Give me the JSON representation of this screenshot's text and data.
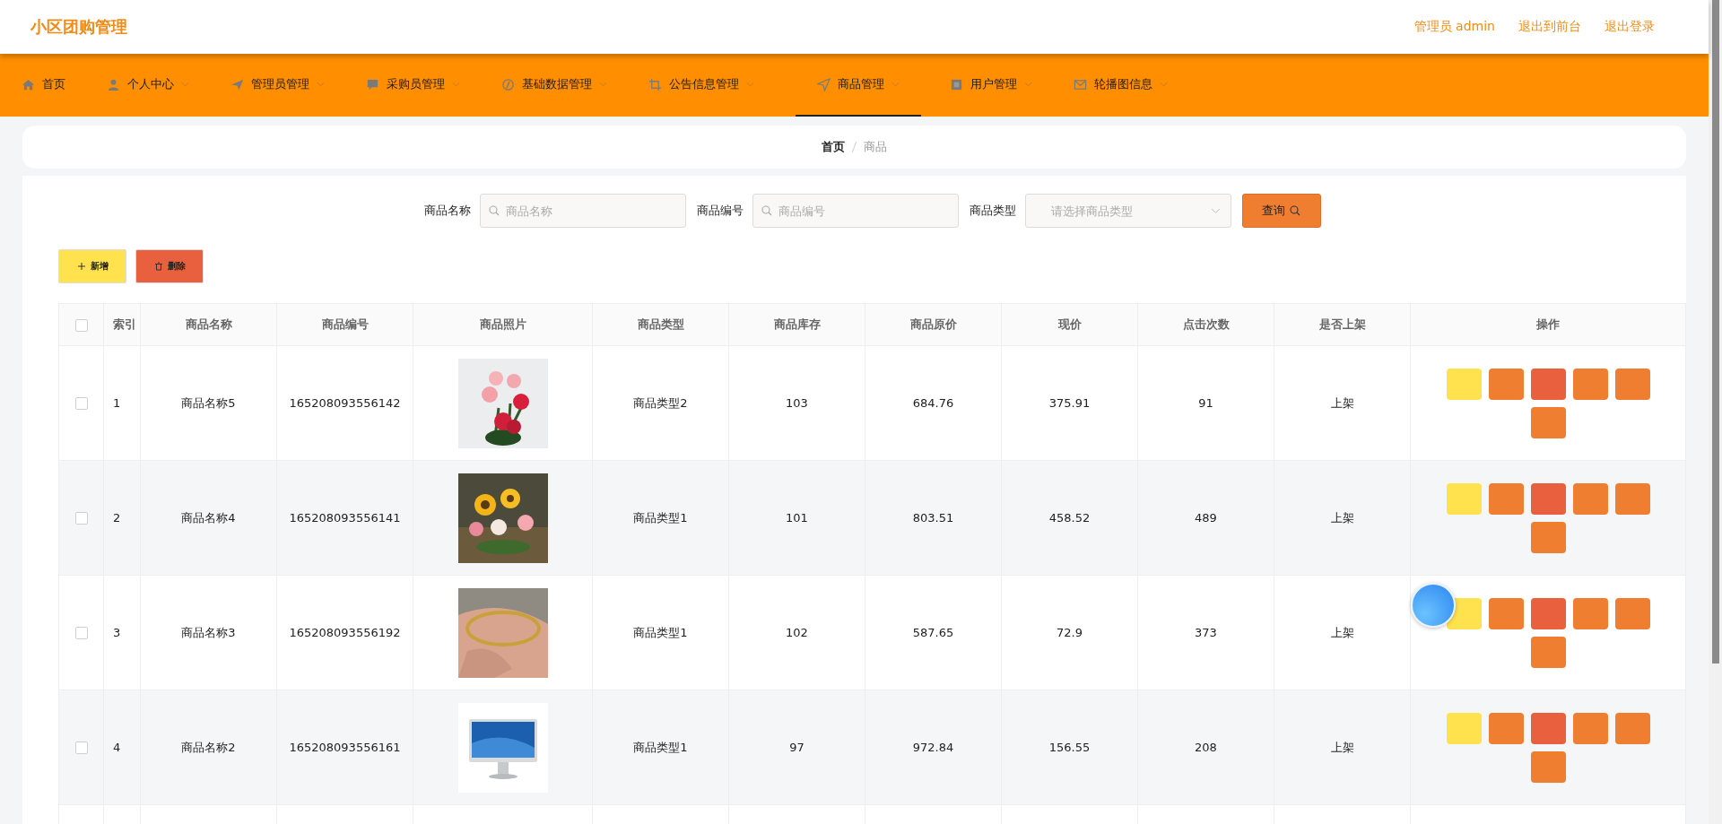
{
  "header": {
    "title": "小区团购管理",
    "links": [
      "管理员 admin",
      "退出到前台",
      "退出登录"
    ]
  },
  "nav": [
    {
      "label": "首页",
      "kind": "home",
      "has_caret": false,
      "selected": false
    },
    {
      "label": "个人中心",
      "kind": "user",
      "has_caret": true,
      "selected": false
    },
    {
      "label": "管理员管理",
      "kind": "plane",
      "has_caret": true,
      "selected": false
    },
    {
      "label": "采购员管理",
      "kind": "chat",
      "has_caret": true,
      "selected": false
    },
    {
      "label": "基础数据管理",
      "kind": "compass",
      "has_caret": true,
      "selected": false
    },
    {
      "label": "公告信息管理",
      "kind": "crop",
      "has_caret": true,
      "selected": false
    },
    {
      "label": "商品管理",
      "kind": "send",
      "has_caret": true,
      "selected": true
    },
    {
      "label": "用户管理",
      "kind": "doc",
      "has_caret": true,
      "selected": false
    },
    {
      "label": "轮播图信息",
      "kind": "mail",
      "has_caret": true,
      "selected": false
    }
  ],
  "breadcrumb": [
    "首页",
    "商品"
  ],
  "search": {
    "fields": [
      {
        "label": "商品名称",
        "placeholder": "商品名称",
        "kind": "text"
      },
      {
        "label": "商品编号",
        "placeholder": "商品编号",
        "kind": "text"
      },
      {
        "label": "商品类型",
        "placeholder": "请选择商品类型",
        "kind": "select"
      }
    ],
    "button": "查询"
  },
  "actions": [
    {
      "label": "新增",
      "kind": "add",
      "color": "#ffe24d"
    },
    {
      "label": "删除",
      "kind": "delete",
      "color": "#e8603e"
    }
  ],
  "table": {
    "all_checked": false,
    "columns": [
      "索引",
      "商品名称",
      "商品编号",
      "商品照片",
      "商品类型",
      "商品库存",
      "商品原价",
      "现价",
      "点击次数",
      "是否上架",
      "操作"
    ],
    "op_buttons": [
      {
        "color": "#ffe24d"
      },
      {
        "color": "#ef7e30"
      },
      {
        "color": "#e8603e"
      },
      {
        "color": "#ef7e30"
      },
      {
        "color": "#ef7e30"
      },
      {
        "color": "#ef7e30"
      }
    ],
    "rows": [
      {
        "checked": false,
        "index": "1",
        "name": "商品名称5",
        "code": "165208093556142",
        "type": "商品类型2",
        "stock": "103",
        "price": "684.76",
        "now": "375.91",
        "clicks": "91",
        "shelf": "上架"
      },
      {
        "checked": false,
        "index": "2",
        "name": "商品名称4",
        "code": "165208093556141",
        "type": "商品类型1",
        "stock": "101",
        "price": "803.51",
        "now": "458.52",
        "clicks": "489",
        "shelf": "上架"
      },
      {
        "checked": false,
        "index": "3",
        "name": "商品名称3",
        "code": "165208093556192",
        "type": "商品类型1",
        "stock": "102",
        "price": "587.65",
        "now": "72.9",
        "clicks": "373",
        "shelf": "上架"
      },
      {
        "checked": false,
        "index": "4",
        "name": "商品名称2",
        "code": "165208093556161",
        "type": "商品类型1",
        "stock": "97",
        "price": "972.84",
        "now": "156.55",
        "clicks": "208",
        "shelf": "上架"
      }
    ]
  }
}
